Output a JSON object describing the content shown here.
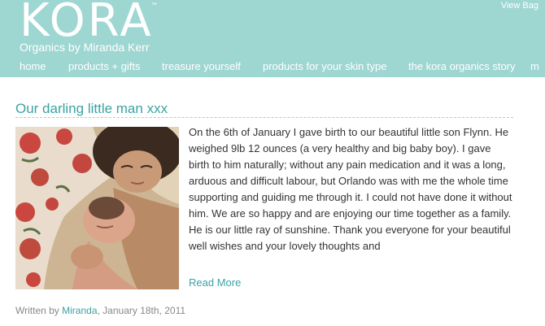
{
  "header": {
    "logo": "KORA",
    "trademark": "™",
    "tagline": "Organics by Miranda Kerr",
    "view_bag": "View Bag"
  },
  "nav": [
    {
      "label": "home"
    },
    {
      "label": "products + gifts"
    },
    {
      "label": "treasure yourself"
    },
    {
      "label": "products for your skin type"
    },
    {
      "label": "the kora organics story"
    },
    {
      "label": "m"
    }
  ],
  "post": {
    "title": "Our darling little man xxx",
    "body": "On the 6th of January I gave birth to our beautiful little son Flynn. He weighed 9lb 12 ounces (a very healthy and big baby boy). I gave birth to him naturally; without any pain medication and it was a long, arduous and difficult labour, but Orlando was with me the whole time supporting and guiding me through it.  I could not have done it without him. We are so happy and are enjoying our time together as a family.  He is our little ray of sunshine. Thank you everyone for your beautiful well wishes and your lovely thoughts and",
    "read_more": "Read More",
    "written_by": "Written by ",
    "author": "Miranda",
    "date": ", January 18th, 2011"
  },
  "colors": {
    "header_bg": "#9ed6d2",
    "accent": "#3aa3a3"
  }
}
